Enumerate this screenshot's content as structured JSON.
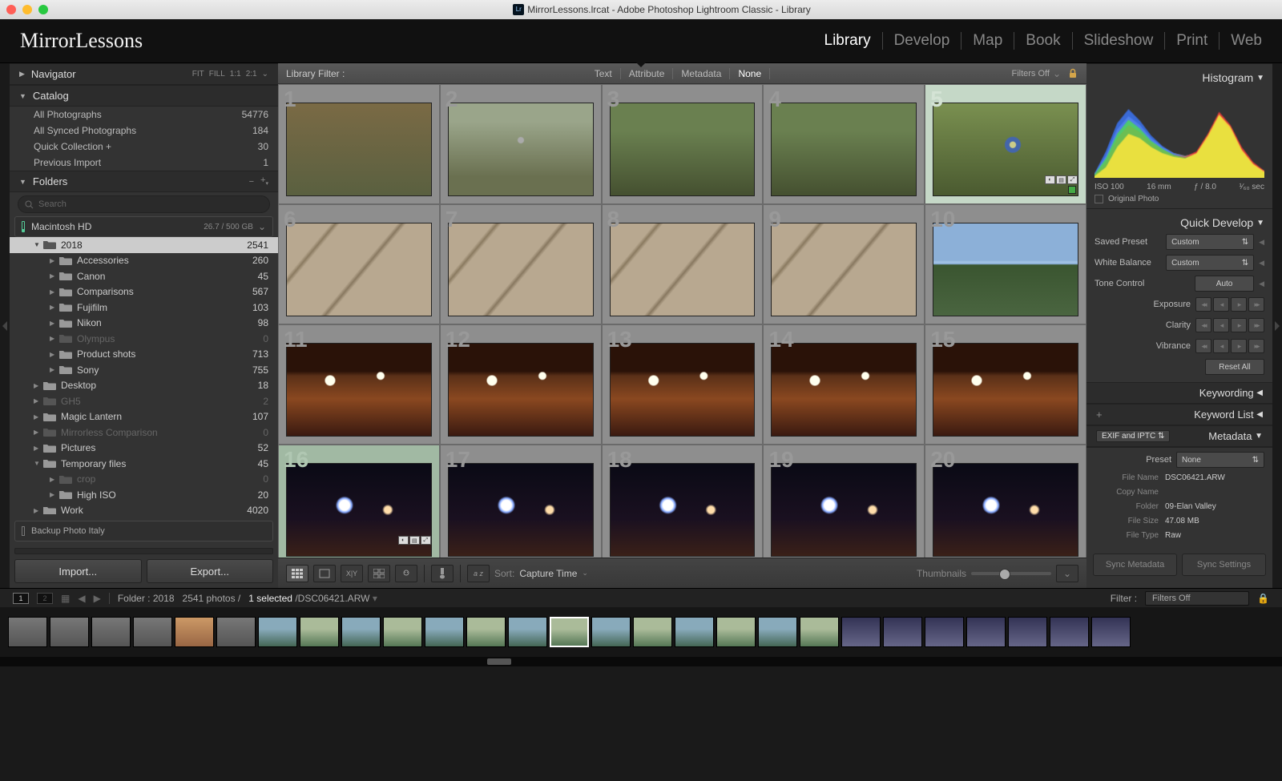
{
  "titlebar": "MirrorLessons.lrcat - Adobe Photoshop Lightroom Classic - Library",
  "brand": "MirrorLessons",
  "modules": [
    "Library",
    "Develop",
    "Map",
    "Book",
    "Slideshow",
    "Print",
    "Web"
  ],
  "activeModule": "Library",
  "navigator": {
    "label": "Navigator",
    "opts": [
      "FIT",
      "FILL",
      "1:1",
      "2:1"
    ]
  },
  "catalog": {
    "label": "Catalog",
    "rows": [
      {
        "name": "All Photographs",
        "count": "54776"
      },
      {
        "name": "All Synced Photographs",
        "count": "184"
      },
      {
        "name": "Quick Collection  +",
        "count": "30"
      },
      {
        "name": "Previous Import",
        "count": "1"
      }
    ]
  },
  "folders": {
    "label": "Folders",
    "search": "Search",
    "volume": "Macintosh HD",
    "volsize": "26.7 / 500 GB"
  },
  "tree": [
    {
      "d": 0,
      "exp": "▼",
      "name": "2018",
      "count": "2541",
      "sel": true
    },
    {
      "d": 1,
      "exp": "▶",
      "name": "Accessories",
      "count": "260"
    },
    {
      "d": 1,
      "exp": "▶",
      "name": "Canon",
      "count": "45"
    },
    {
      "d": 1,
      "exp": "▶",
      "name": "Comparisons",
      "count": "567"
    },
    {
      "d": 1,
      "exp": "▶",
      "name": "Fujifilm",
      "count": "103"
    },
    {
      "d": 1,
      "exp": "▶",
      "name": "Nikon",
      "count": "98"
    },
    {
      "d": 1,
      "exp": "▶",
      "name": "Olympus",
      "count": "0",
      "dim": true
    },
    {
      "d": 1,
      "exp": "▶",
      "name": "Product shots",
      "count": "713"
    },
    {
      "d": 1,
      "exp": "▶",
      "name": "Sony",
      "count": "755"
    },
    {
      "d": 0,
      "exp": "▶",
      "name": "Desktop",
      "count": "18"
    },
    {
      "d": 0,
      "exp": "▶",
      "name": "GH5",
      "count": "2",
      "dim": true
    },
    {
      "d": 0,
      "exp": "▶",
      "name": "Magic Lantern",
      "count": "107"
    },
    {
      "d": 0,
      "exp": "▶",
      "name": "Mirrorless Comparison",
      "count": "0",
      "dim": true
    },
    {
      "d": 0,
      "exp": "▶",
      "name": "Pictures",
      "count": "52"
    },
    {
      "d": 0,
      "exp": "▼",
      "name": "Temporary files",
      "count": "45"
    },
    {
      "d": 1,
      "exp": "▶",
      "name": "crop",
      "count": "0",
      "dim": true
    },
    {
      "d": 1,
      "exp": "▶",
      "name": "High ISO",
      "count": "20"
    },
    {
      "d": 0,
      "exp": "▶",
      "name": "Work",
      "count": "4020"
    }
  ],
  "backup": "Backup Photo Italy",
  "importBtn": "Import...",
  "exportBtn": "Export...",
  "filter": {
    "label": "Library Filter :",
    "items": [
      "Text",
      "Attribute",
      "Metadata",
      "None"
    ],
    "active": "None",
    "state": "Filters Off"
  },
  "thumbs": [
    {
      "n": "1",
      "c": "nat1"
    },
    {
      "n": "2",
      "c": "nat2"
    },
    {
      "n": "3",
      "c": "nat3"
    },
    {
      "n": "4",
      "c": "nat3"
    },
    {
      "n": "5",
      "c": "blue",
      "sel": true,
      "badge": true,
      "tb": true
    },
    {
      "n": "6",
      "c": "branch"
    },
    {
      "n": "7",
      "c": "branch"
    },
    {
      "n": "8",
      "c": "branch"
    },
    {
      "n": "9",
      "c": "branch"
    },
    {
      "n": "10",
      "c": "land"
    },
    {
      "n": "11",
      "c": "crowd"
    },
    {
      "n": "12",
      "c": "crowd"
    },
    {
      "n": "13",
      "c": "crowd"
    },
    {
      "n": "14",
      "c": "crowd"
    },
    {
      "n": "15",
      "c": "crowd"
    },
    {
      "n": "16",
      "c": "night",
      "pick": true,
      "tb": true
    },
    {
      "n": "17",
      "c": "night"
    },
    {
      "n": "18",
      "c": "night"
    },
    {
      "n": "19",
      "c": "night"
    },
    {
      "n": "20",
      "c": "night"
    }
  ],
  "toolbar": {
    "sort": "Sort:",
    "sortby": "Capture Time",
    "thumbs": "Thumbnails"
  },
  "right": {
    "histogram": "Histogram",
    "hist": {
      "iso": "ISO 100",
      "fl": "16 mm",
      "ap": "ƒ / 8.0",
      "sh": "¹⁄₆₀ sec",
      "orig": "Original Photo"
    },
    "quickdev": "Quick Develop",
    "saved": "Saved Preset",
    "wb": "White Balance",
    "tone": "Tone Control",
    "auto": "Auto",
    "custom": "Custom",
    "exp": "Exposure",
    "clarity": "Clarity",
    "vib": "Vibrance",
    "reset": "Reset All",
    "keywording": "Keywording",
    "keywordlist": "Keyword List",
    "metadata": "Metadata",
    "metamode": "EXIF and IPTC",
    "preset": "Preset",
    "none": "None",
    "mrows": [
      {
        "l": "File Name",
        "v": "DSC06421.ARW"
      },
      {
        "l": "Copy Name",
        "v": ""
      },
      {
        "l": "Folder",
        "v": "09-Elan Valley"
      },
      {
        "l": "File Size",
        "v": "47.08 MB"
      },
      {
        "l": "File Type",
        "v": "Raw"
      }
    ],
    "syncmeta": "Sync Metadata",
    "syncset": "Sync Settings"
  },
  "infobar": {
    "folder": "Folder : 2018",
    "count": "2541 photos /",
    "sel": "1 selected",
    "file": "/DSC06421.ARW",
    "filter": "Filter :",
    "filtersoff": "Filters Off"
  }
}
